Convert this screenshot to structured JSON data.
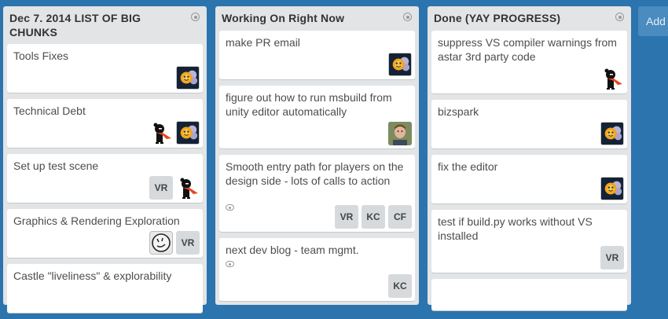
{
  "lists": [
    {
      "title": "Dec 7. 2014 LIST OF BIG CHUNKS",
      "cards": [
        {
          "title": "Tools Fixes",
          "members": [
            "sun-avatar"
          ]
        },
        {
          "title": "Technical Debt",
          "members": [
            "ninja-avatar",
            "sun-avatar"
          ]
        },
        {
          "title": "Set up test scene",
          "members": [
            "VR",
            "ninja-avatar"
          ]
        },
        {
          "title": "Graphics & Rendering Exploration",
          "members": [
            "sketch-avatar",
            "VR"
          ]
        },
        {
          "title": "Castle \"liveliness\" & explorability",
          "members": []
        }
      ]
    },
    {
      "title": "Working On Right Now",
      "cards": [
        {
          "title": "make PR email",
          "members": [
            "sun-avatar"
          ]
        },
        {
          "title": "figure out how to run msbuild from unity editor automatically",
          "members": [
            "photo-avatar"
          ]
        },
        {
          "title": "Smooth entry path for players on the design side - lots of calls to action",
          "members": [
            "VR",
            "KC",
            "CF"
          ],
          "watched": true
        },
        {
          "title": "next dev blog - team mgmt.",
          "members": [
            "KC"
          ],
          "watched": true
        }
      ]
    },
    {
      "title": "Done (YAY PROGRESS)",
      "cards": [
        {
          "title": "suppress VS compiler warnings from astar 3rd party code",
          "members": [
            "ninja-avatar"
          ]
        },
        {
          "title": "bizspark",
          "members": [
            "sun-avatar"
          ]
        },
        {
          "title": "fix the editor",
          "members": [
            "sun-avatar"
          ]
        },
        {
          "title": "test if build.py works without VS installed",
          "members": [
            "VR"
          ]
        }
      ]
    }
  ],
  "add_list_label": "Add"
}
